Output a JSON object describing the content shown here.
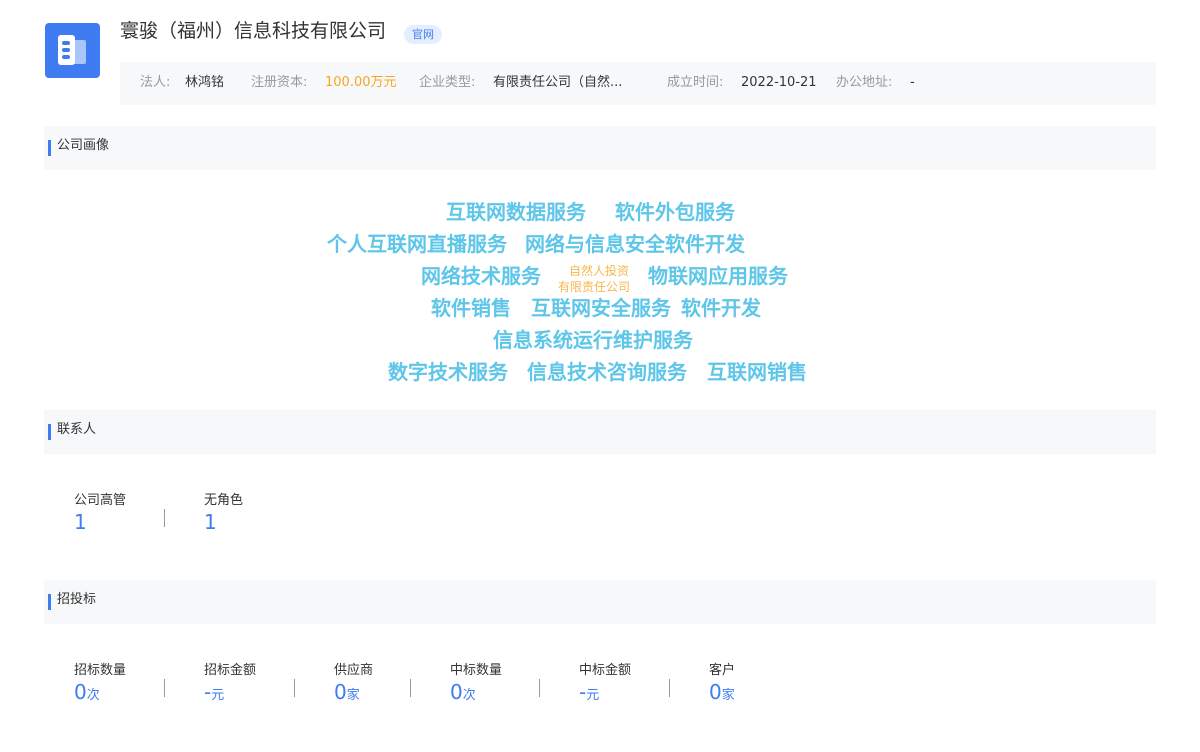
{
  "header": {
    "company_name": "寰骏（福州）信息科技有限公司",
    "website_badge": "官网",
    "info": {
      "legal_person_label": "法人:",
      "legal_person_value": "林鸿铭",
      "capital_label": "注册资本:",
      "capital_value": "100.00万元",
      "type_label": "企业类型:",
      "type_value": "有限责任公司（自然...",
      "founded_label": "成立时间:",
      "founded_value": "2022-10-21",
      "address_label": "办公地址:",
      "address_value": "-"
    }
  },
  "portrait": {
    "title": "公司画像",
    "words": [
      "互联网数据服务",
      "软件外包服务",
      "个人互联网直播服务",
      "网络与信息安全软件开发",
      "网络技术服务",
      "自然人投资",
      "有限责任公司",
      "物联网应用服务",
      "软件销售",
      "互联网安全服务",
      "软件开发",
      "信息系统运行维护服务",
      "数字技术服务",
      "信息技术咨询服务",
      "互联网销售"
    ]
  },
  "contacts": {
    "title": "联系人",
    "stats": [
      {
        "label": "公司高管",
        "value": "1",
        "unit": ""
      },
      {
        "label": "无角色",
        "value": "1",
        "unit": ""
      }
    ]
  },
  "bidding": {
    "title": "招投标",
    "stats": [
      {
        "label": "招标数量",
        "value": "0",
        "unit": "次"
      },
      {
        "label": "招标金额",
        "value": "-",
        "unit": "元"
      },
      {
        "label": "供应商",
        "value": "0",
        "unit": "家"
      },
      {
        "label": "中标数量",
        "value": "0",
        "unit": "次"
      },
      {
        "label": "中标金额",
        "value": "-",
        "unit": "元"
      },
      {
        "label": "客户",
        "value": "0",
        "unit": "家"
      }
    ]
  },
  "colors": {
    "accent": "#3f7bf1",
    "capital": "#f5a623",
    "tag_cloud": "#5ec6e8",
    "tag_small": "#f5b94a"
  }
}
